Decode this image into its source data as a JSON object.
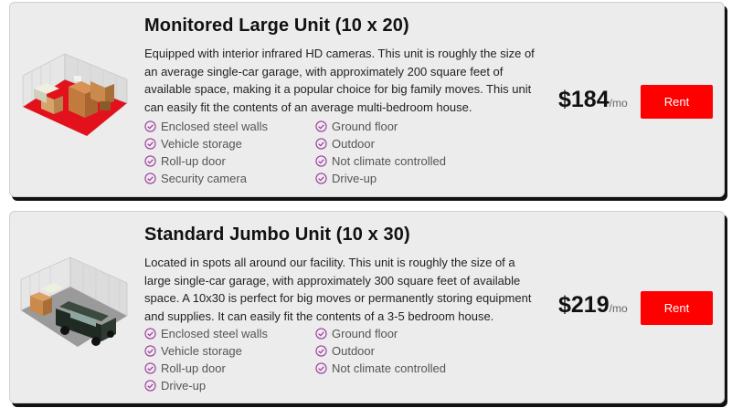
{
  "units": [
    {
      "title": "Monitored Large Unit (10 x 20)",
      "description": "Equipped with interior infrared HD cameras. This unit is roughly the size of an average single-car garage, with approximately 200 square feet of available space, making it a popular choice for big family moves. This unit can easily fit the contents of an average multi-bedroom house.",
      "features_left": [
        "Enclosed steel walls",
        "Vehicle storage",
        "Roll-up door",
        "Security camera"
      ],
      "features_right": [
        "Ground floor",
        "Outdoor",
        "Not climate controlled",
        "Drive-up"
      ],
      "price": "$184",
      "period": "/mo",
      "button": "Rent"
    },
    {
      "title": "Standard Jumbo Unit (10 x 30)",
      "description": "Located in spots all around our facility. This unit is roughly the size of a large single-car garage, with approximately 300 square feet of available space. A 10x30 is perfect for big moves or permanently storing equipment and supplies. It can easily fit the contents of a 3-5 bedroom house.",
      "features_left": [
        "Enclosed steel walls",
        "Vehicle storage",
        "Roll-up door",
        "Drive-up"
      ],
      "features_right": [
        "Ground floor",
        "Outdoor",
        "Not climate controlled"
      ],
      "price": "$219",
      "period": "/mo",
      "button": "Rent"
    }
  ],
  "icons": {
    "feature": "check-circle-icon"
  },
  "colors": {
    "accent": "#ff0000",
    "check": "#9c3a9c",
    "card_bg": "#ececec"
  }
}
